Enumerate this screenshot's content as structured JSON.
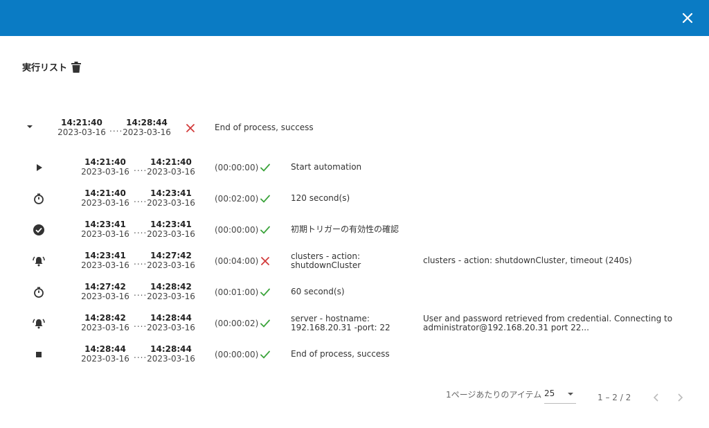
{
  "dialog": {
    "title": "実行リスト"
  },
  "parent": {
    "start_time": "14:21:40",
    "start_date": "2023-03-16",
    "end_time": "14:28:44",
    "end_date": "2023-03-16",
    "separator": "....",
    "description": "End of process, success",
    "status": "error"
  },
  "steps": [
    {
      "icon": "play-icon",
      "start_time": "14:21:40",
      "start_date": "2023-03-16",
      "end_time": "14:21:40",
      "end_date": "2023-03-16",
      "separator": "....",
      "duration": "(00:00:00)",
      "status": "success",
      "desc1": "Start automation",
      "desc2": "",
      "detail1": "",
      "detail2": ""
    },
    {
      "icon": "stopwatch-icon",
      "start_time": "14:21:40",
      "start_date": "2023-03-16",
      "end_time": "14:23:41",
      "end_date": "2023-03-16",
      "separator": "....",
      "duration": "(00:02:00)",
      "status": "success",
      "desc1": "120 second(s)",
      "desc2": "",
      "detail1": "",
      "detail2": ""
    },
    {
      "icon": "check-circle-icon",
      "start_time": "14:23:41",
      "start_date": "2023-03-16",
      "end_time": "14:23:41",
      "end_date": "2023-03-16",
      "separator": "....",
      "duration": "(00:00:00)",
      "status": "success",
      "desc1": "初期トリガーの有効性の確認",
      "desc2": "",
      "detail1": "",
      "detail2": ""
    },
    {
      "icon": "bell-alert-icon",
      "start_time": "14:23:41",
      "start_date": "2023-03-16",
      "end_time": "14:27:42",
      "end_date": "2023-03-16",
      "separator": "....",
      "duration": "(00:04:00)",
      "status": "error",
      "desc1": "clusters - action:",
      "desc2": "shutdownCluster",
      "detail1": "clusters - action: shutdownCluster, timeout (240s)",
      "detail2": ""
    },
    {
      "icon": "stopwatch-icon",
      "start_time": "14:27:42",
      "start_date": "2023-03-16",
      "end_time": "14:28:42",
      "end_date": "2023-03-16",
      "separator": "....",
      "duration": "(00:01:00)",
      "status": "success",
      "desc1": "60 second(s)",
      "desc2": "",
      "detail1": "",
      "detail2": ""
    },
    {
      "icon": "bell-alert-icon",
      "start_time": "14:28:42",
      "start_date": "2023-03-16",
      "end_time": "14:28:44",
      "end_date": "2023-03-16",
      "separator": "....",
      "duration": "(00:00:02)",
      "status": "success",
      "desc1": "server - hostname:",
      "desc2": "192.168.20.31 -port: 22",
      "detail1": "User and password retrieved from credential. Connecting to",
      "detail2": "administrator@192.168.20.31 port 22..."
    },
    {
      "icon": "stop-icon",
      "start_time": "14:28:44",
      "start_date": "2023-03-16",
      "end_time": "14:28:44",
      "end_date": "2023-03-16",
      "separator": "....",
      "duration": "(00:00:00)",
      "status": "success",
      "desc1": "End of process, success",
      "desc2": "",
      "detail1": "",
      "detail2": ""
    }
  ],
  "pagination": {
    "items_per_page_label": "1ページあたりのアイテム",
    "page_size": "25",
    "range": "1 – 2 / 2"
  },
  "colors": {
    "header": "#0a7bc4",
    "success": "#3aa33a",
    "error": "#d23b3b"
  }
}
